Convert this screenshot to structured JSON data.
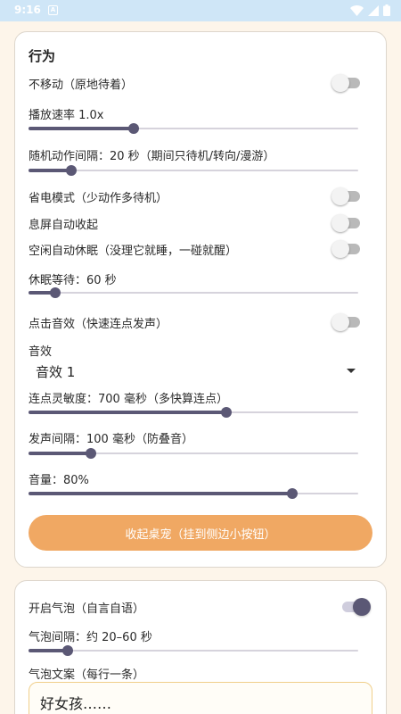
{
  "status_bar": {
    "time": "9:16",
    "notif_glyph": "A",
    "icons": [
      "wifi-icon",
      "signal-icon",
      "battery-icon"
    ]
  },
  "behavior": {
    "title": "行为",
    "no_move": {
      "label": "不移动（原地待着）",
      "on": false
    },
    "speed": {
      "label": "播放速率 1.0x",
      "value_fraction": 0.32
    },
    "random_interval": {
      "label": "随机动作间隔：20 秒（期间只待机/转向/漫游）",
      "value_fraction": 0.13
    },
    "power_save": {
      "label": "省电模式（少动作多待机）",
      "on": false
    },
    "screen_off_collapse": {
      "label": "息屏自动收起",
      "on": false
    },
    "idle_sleep": {
      "label": "空闲自动休眠（没理它就睡，一碰就醒）",
      "on": false
    },
    "sleep_wait": {
      "label": "休眠等待：60 秒",
      "value_fraction": 0.08
    },
    "click_sound": {
      "label": "点击音效（快速连点发声）",
      "on": false
    },
    "sound_effect": {
      "label": "音效",
      "selected": "音效 1"
    },
    "tap_sensitivity": {
      "label": "连点灵敏度：700 毫秒（多快算连点）",
      "value_fraction": 0.6
    },
    "sound_interval": {
      "label": "发声间隔：100 毫秒（防叠音）",
      "value_fraction": 0.19
    },
    "volume": {
      "label": "音量：80%",
      "value_fraction": 0.8
    },
    "collapse_button": "收起桌宠（挂到侧边小按钮）"
  },
  "bubble": {
    "enable": {
      "label": "开启气泡（自言自语）",
      "on": true
    },
    "interval": {
      "label": "气泡间隔：约 20–60 秒",
      "value_fraction": 0.12
    },
    "text_label": "气泡文案（每行一条）",
    "text_value": "好女孩……"
  },
  "colors": {
    "accent": "#5b5875",
    "button": "#f0a863",
    "background": "#fdf5ea"
  }
}
